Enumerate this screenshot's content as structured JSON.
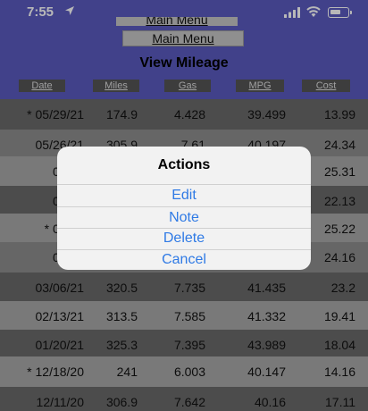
{
  "status": {
    "time": "7:55"
  },
  "header": {
    "top_button_label": "Main Menu",
    "main_menu_label": "Main Menu",
    "title": "View Mileage",
    "columns": [
      "Date",
      "Miles",
      "Gas",
      "MPG",
      "Cost"
    ]
  },
  "rows": [
    {
      "date": "* 05/29/21",
      "miles": "174.9",
      "gas": "4.428",
      "mpg": "39.499",
      "cost": "13.99"
    },
    {
      "date": "05/26/21",
      "miles": "305.9",
      "gas": "7.61",
      "mpg": "40.197",
      "cost": "24.34"
    },
    {
      "date": "05/07",
      "miles": "",
      "gas": "",
      "mpg": "",
      "cost": "25.31"
    },
    {
      "date": "04/24",
      "miles": "",
      "gas": "",
      "mpg": "",
      "cost": "22.13"
    },
    {
      "date": "* 04/10",
      "miles": "",
      "gas": "",
      "mpg": "",
      "cost": "25.22"
    },
    {
      "date": "03/25",
      "miles": "",
      "gas": "",
      "mpg": "",
      "cost": "24.16"
    },
    {
      "date": "03/06/21",
      "miles": "320.5",
      "gas": "7.735",
      "mpg": "41.435",
      "cost": "23.2"
    },
    {
      "date": "02/13/21",
      "miles": "313.5",
      "gas": "7.585",
      "mpg": "41.332",
      "cost": "19.41"
    },
    {
      "date": "01/20/21",
      "miles": "325.3",
      "gas": "7.395",
      "mpg": "43.989",
      "cost": "18.04"
    },
    {
      "date": "* 12/18/20",
      "miles": "241",
      "gas": "6.003",
      "mpg": "40.147",
      "cost": "14.16"
    },
    {
      "date": "12/11/20",
      "miles": "306.9",
      "gas": "7.642",
      "mpg": "40.16",
      "cost": "17.11"
    }
  ],
  "dialog": {
    "title": "Actions",
    "edit": "Edit",
    "note": "Note",
    "delete": "Delete",
    "cancel": "Cancel"
  },
  "colors": {
    "header_bg": "#5a5bbf",
    "action_blue": "#2f7ae5"
  }
}
